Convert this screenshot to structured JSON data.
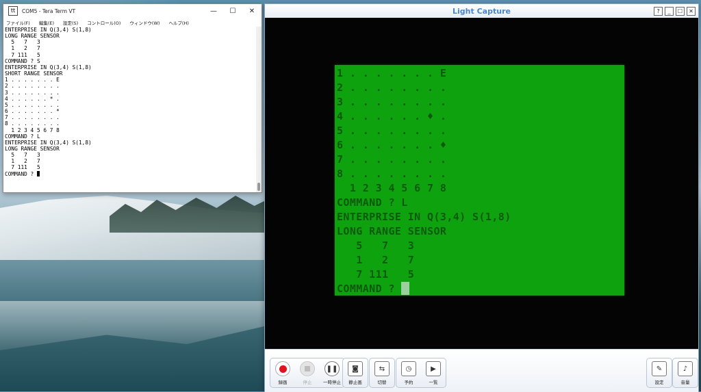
{
  "teraterm": {
    "title": "COM5 - Tera Term VT",
    "title_icon": "tt",
    "controls": {
      "minimize": "—",
      "maximize": "☐",
      "close": "✕"
    },
    "menu": [
      "ファイル(F)",
      "編集(E)",
      "設定(S)",
      "コントロール(O)",
      "ウィンドウ(W)",
      "ヘルプ(H)"
    ],
    "lines": [
      "ENTERPRISE IN Q(3,4) S(1,8)",
      "LONG RANGE SENSOR",
      "  5   7   3",
      "  1   2   7",
      "  7 111   5",
      "COMMAND ? S",
      "ENTERPRISE IN Q(3,4) S(1,8)",
      "SHORT RANGE SENSOR",
      "1 . . . . . . . E",
      "2 . . . . . . . .",
      "3 . . . . . . . .",
      "4 . . . . . . * .",
      "5 . . . . . . . .",
      "6 . . . . . . . *",
      "7 . . . . . . . .",
      "8 . . . . . . . .",
      "  1 2 3 4 5 6 7 8",
      "COMMAND ? L",
      "ENTERPRISE IN Q(3,4) S(1,8)",
      "LONG RANGE SENSOR",
      "  5   7   3",
      "  1   2   7",
      "  7 111   5"
    ],
    "prompt": "COMMAND ? "
  },
  "lightcapture": {
    "title": "Light Capture",
    "controls": {
      "help": "?",
      "minimize": "_",
      "maximize": "☐",
      "close": "✕"
    },
    "screen_lines": [
      "1 . . . . . . . E",
      "2 . . . . . . . .",
      "3 . . . . . . . .",
      "4 . . . . . . ♦ .",
      "5 . . . . . . . .",
      "6 . . . . . . . ♦",
      "7 . . . . . . . .",
      "8 . . . . . . . .",
      "  1 2 3 4 5 6 7 8",
      "COMMAND ? L",
      "ENTERPRISE IN Q(3,4) S(1,8)",
      "LONG RANGE SENSOR",
      "   5   7   3",
      "   1   2   7",
      "   7 111   5"
    ],
    "screen_prompt": "COMMAND ? ",
    "toolbar": {
      "record": "録画",
      "stop": "停止",
      "pause": "一時停止",
      "snapshot": "静止画",
      "switch": "切替",
      "schedule": "予約",
      "list": "一覧",
      "settings": "設定",
      "volume": "音量"
    }
  },
  "colors": {
    "phosphor_green": "#0ea30e",
    "text_green": "#0b5a0b",
    "title_blue": "#4a87c8"
  }
}
